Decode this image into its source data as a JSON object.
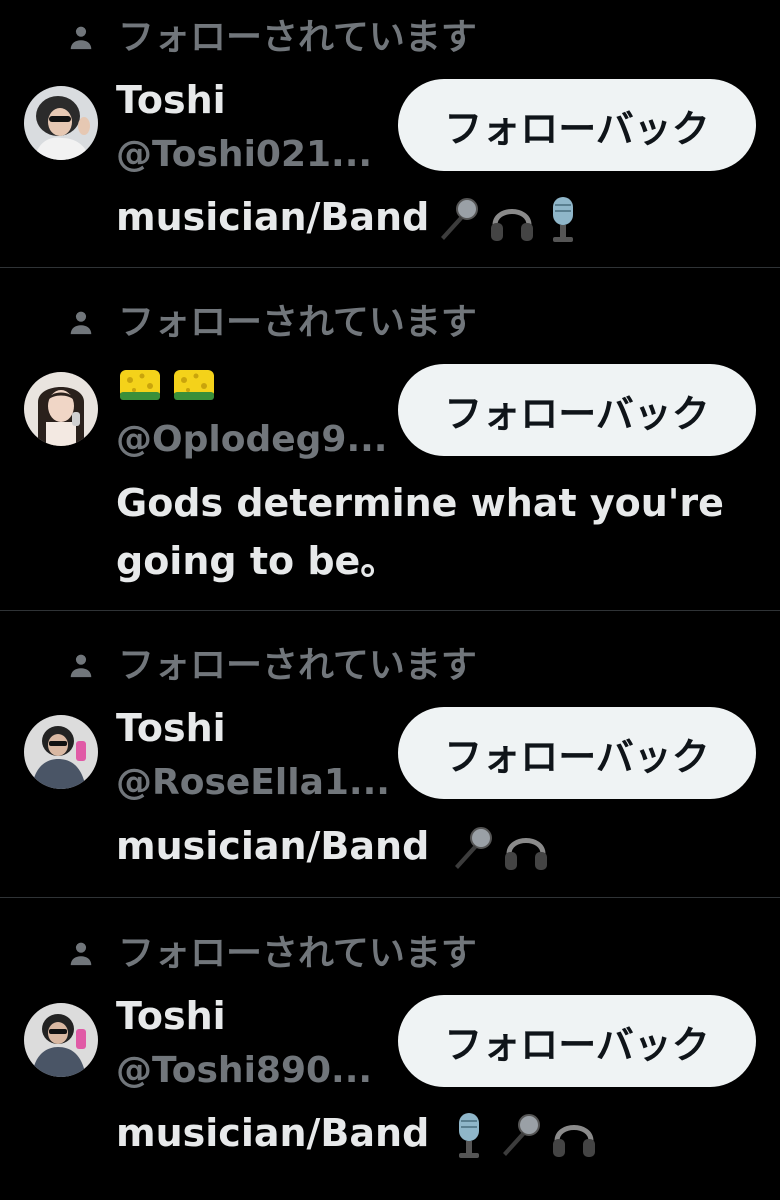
{
  "follow_label": "フォローされています",
  "follow_back_label": "フォローバック",
  "items": [
    {
      "name": "Toshi",
      "handle": "@Toshi021...",
      "bio": "musician/Band",
      "bio_emojis": [
        "microphone-icon",
        "headphones-icon",
        "studio-microphone-icon"
      ]
    },
    {
      "name_emojis": [
        "sponge-icon",
        "sponge-icon"
      ],
      "handle": "@Oplodeg9...",
      "bio_line1": "Gods determine what you're",
      "bio_line2": "going to be。"
    },
    {
      "name": "Toshi",
      "handle": "@RoseElla1...",
      "bio": "musician/Band",
      "bio_emojis": [
        "microphone-icon",
        "headphones-icon"
      ]
    },
    {
      "name": "Toshi",
      "handle": "@Toshi890...",
      "bio": "musician/Band",
      "bio_emojis": [
        "studio-microphone-icon",
        "microphone-icon",
        "headphones-icon"
      ]
    }
  ],
  "colors": {
    "background": "#000000",
    "text_primary": "#e7e9ea",
    "text_secondary": "#71767b",
    "divider": "#2f3336",
    "button_bg": "#eff3f4",
    "button_text": "#0f1419"
  }
}
